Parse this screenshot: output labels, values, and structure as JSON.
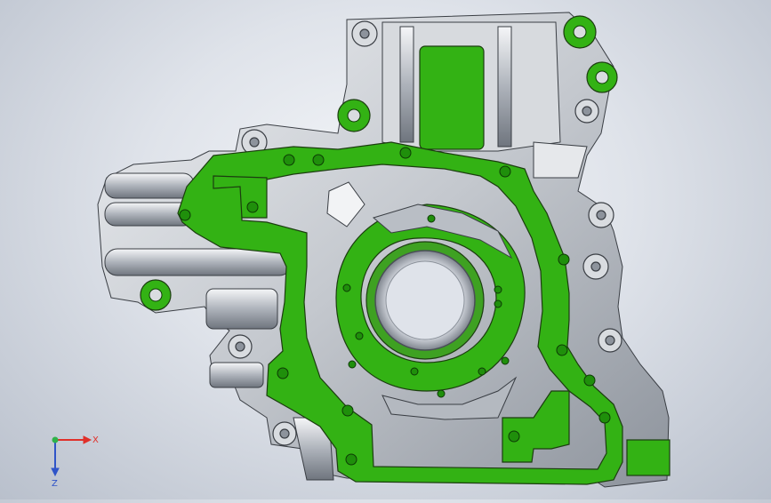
{
  "viewport": {
    "background_top": "#f4f6f9",
    "background_bottom": "#b9c0cc",
    "part_face_color": "#33b214",
    "part_body_color": "#c9cdd3",
    "hole_color": "#1f8f0b"
  },
  "triad": {
    "x_label": "X",
    "z_label": "Z",
    "x_color": "#e0302a",
    "y_color": "#2fb24a",
    "z_color": "#2f54c8"
  }
}
